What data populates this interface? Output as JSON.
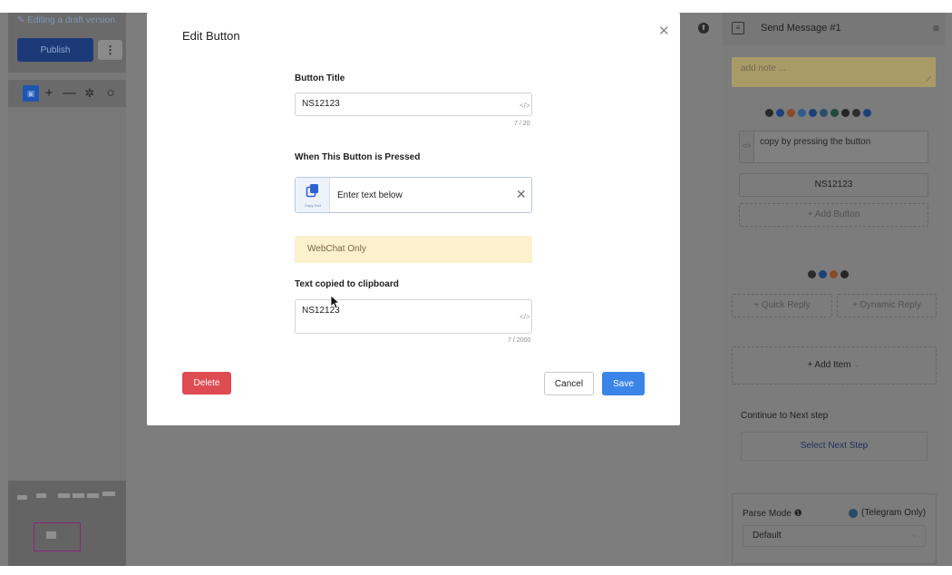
{
  "left_panel": {
    "draft_label": "Editing a draft version",
    "publish_label": "Publish",
    "more_label": "⋮",
    "tools": {
      "flow_icon": "flow-icon",
      "plus": "+",
      "minus": "—",
      "magic": "✲",
      "search": "○"
    }
  },
  "right_panel": {
    "title": "Send Message #1",
    "note_placeholder": "add note ...",
    "text_card": "copy by pressing the button",
    "button_label": "NS12123",
    "add_button": "+ Add Button",
    "quick_reply": "+ Quick Reply",
    "dynamic_reply": "+ Dynamic Reply",
    "add_item": "+ Add Item",
    "add_item_chevron": "⌄",
    "continue_label": "Continue to Next step",
    "select_next_step": "Select Next Step",
    "parse_mode_label": "Parse Mode ❶",
    "parse_mode_note": "(Telegram Only)",
    "parse_mode_value": "Default",
    "channels_top": [
      "#2a2a2a",
      "#1e3f7a",
      "#8a4a2a",
      "#2f5a8a",
      "#1e3f7a",
      "#2c4e6a",
      "#1e4a3a",
      "#262626",
      "#2d2d2d",
      "#1e3f7a"
    ],
    "channels_bottom": [
      "#2a2a2a",
      "#1e3f7a",
      "#8a4a2a",
      "#262626"
    ]
  },
  "modal": {
    "title": "Edit Button",
    "button_title_label": "Button Title",
    "button_title_value": "NS12123",
    "button_title_counter": "7 / 20",
    "pressed_label": "When This Button is Pressed",
    "action_caption": "Copy Text",
    "action_text": "Enter text below",
    "webchat_badge": "WebChat Only",
    "copied_label": "Text copied to clipboard",
    "copied_value": "NS12123",
    "copied_counter": "7 / 2000",
    "delete_label": "Delete",
    "cancel_label": "Cancel",
    "save_label": "Save"
  },
  "icons": {
    "close": "✕",
    "code": "</>",
    "message": "≡",
    "upload": "⬆"
  }
}
